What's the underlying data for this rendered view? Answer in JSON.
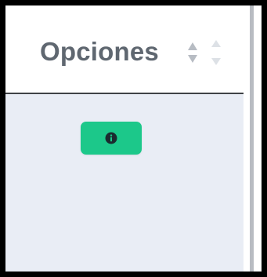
{
  "table": {
    "header": {
      "label": "Opciones",
      "sort_icon": "sort-both-icon",
      "sort_icon_secondary": "sort-faded-icon"
    },
    "rows": [
      {
        "action_icon": "info-circle-icon",
        "action_color": "#1cc88a"
      }
    ]
  },
  "colors": {
    "header_text": "#5f6770",
    "row_background": "#e9edf5",
    "button_accent": "#1cc88a",
    "icon_color": "#1b2a2f"
  }
}
